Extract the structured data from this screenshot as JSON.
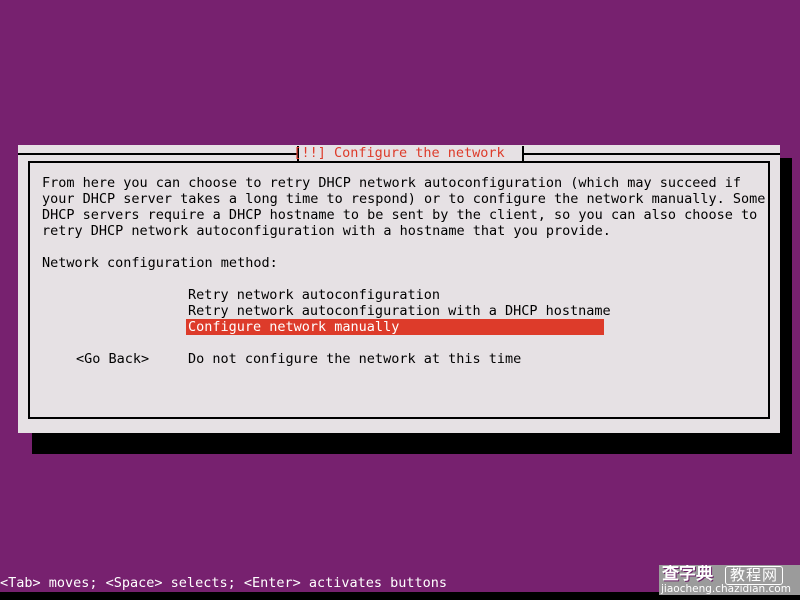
{
  "screen": {
    "background_color": "#77216f",
    "bottom_strip_color": "#000000"
  },
  "dialog": {
    "title": "[!!] Configure the network",
    "title_color": "#dd3b2a",
    "background_color": "#e6e1e4",
    "border_color": "#000000",
    "body_text": "From here you can choose to retry DHCP network autoconfiguration (which may succeed if\nyour DHCP server takes a long time to respond) or to configure the network manually. Some\nDHCP servers require a DHCP hostname to be sent by the client, so you can also choose to\nretry DHCP network autoconfiguration with a hostname that you provide.",
    "prompt_label": "Network configuration method:",
    "options": [
      {
        "label": "Retry network autoconfiguration",
        "selected": false
      },
      {
        "label": "Retry network autoconfiguration with a DHCP hostname",
        "selected": false
      },
      {
        "label": "Configure network manually",
        "selected": true
      },
      {
        "label": "Do not configure the network at this time",
        "selected": false
      }
    ],
    "selected_option_label": "Configure network manually",
    "selection_background_color": "#dd3b2a",
    "selection_text_color": "#ffffff",
    "go_back_button": "<Go Back>"
  },
  "status_bar": {
    "text": "<Tab> moves; <Space> selects; <Enter> activates buttons",
    "text_color": "#ffffff"
  },
  "watermark": {
    "chinese_primary": "查字典",
    "chinese_secondary": "教程网",
    "url": "jiaocheng.chazidian.com"
  }
}
